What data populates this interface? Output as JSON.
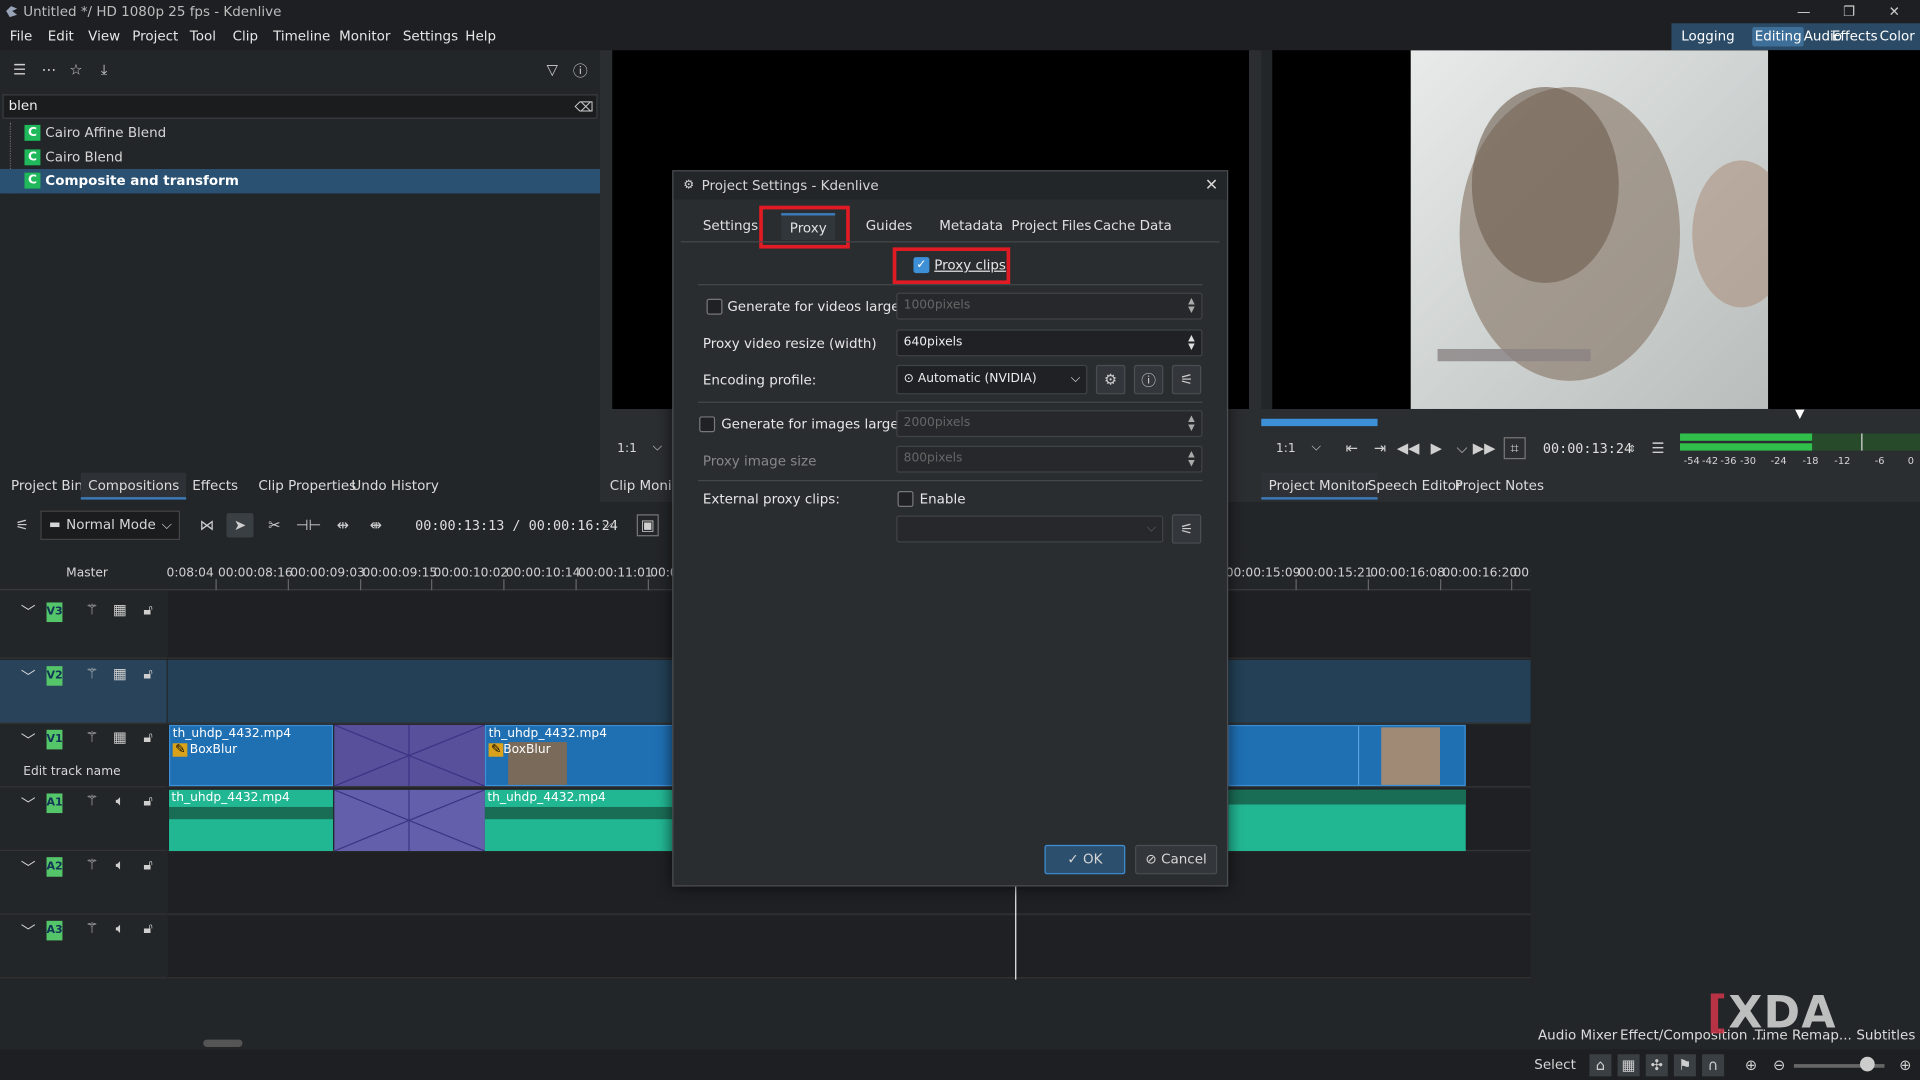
{
  "window": {
    "title": "Untitled */ HD 1080p 25 fps - Kdenlive",
    "controls": [
      "—",
      "❐",
      "✕"
    ]
  },
  "menu": [
    "File",
    "Edit",
    "View",
    "Project",
    "Tool",
    "Clip",
    "Timeline",
    "Monitor",
    "Settings",
    "Help"
  ],
  "layouts": [
    {
      "label": "Logging"
    },
    {
      "label": "Editing",
      "active": true
    },
    {
      "label": "Audio"
    },
    {
      "label": "Effects"
    },
    {
      "label": "Color"
    }
  ],
  "bin": {
    "search": "blen",
    "items": [
      {
        "label": "Cairo Affine Blend",
        "badge": "C"
      },
      {
        "label": "Cairo Blend",
        "badge": "C"
      },
      {
        "label": "Composite and transform",
        "badge": "C",
        "selected": true
      }
    ]
  },
  "leftTabs": [
    "Project Bin",
    "Compositions",
    "Effects",
    "Clip Properties",
    "Undo History"
  ],
  "clipMonitor": {
    "zoom": "1:1",
    "tab": "Clip Monito"
  },
  "projectMonitor": {
    "zoom": "1:1",
    "timecode": "00:00:13:24",
    "tabs": [
      "Project Monitor",
      "Speech Editor",
      "Project Notes"
    ],
    "meterLabels": [
      "-54",
      "-42",
      "-36",
      "-30",
      "-24",
      "-18",
      "-12",
      "-6",
      "0"
    ]
  },
  "timeline": {
    "mode": "Normal Mode",
    "timecode": "00:00:13:13 / 00:00:16:24",
    "master": "Master",
    "rulerLeft": [
      "0:08:04",
      "00:00:08:16",
      "00:00:09:03",
      "00:00:09:15",
      "00:00:10:02",
      "00:00:10:14",
      "00:00:11:01",
      "00:0"
    ],
    "rulerRight": [
      "00:00:15:09",
      "00:00:15:21",
      "00:00:16:08",
      "00:00:16:20",
      "00:"
    ],
    "tracks": [
      "V3",
      "V2",
      "V1",
      "A1",
      "A2",
      "A3"
    ],
    "editName": "Edit track name",
    "clipName": "th_uhdp_4432.mp4",
    "effect": "BoxBlur"
  },
  "rightTabs": [
    "Audio Mixer",
    "Effect/Composition ...",
    "Time Remap...",
    "Subtitles"
  ],
  "status": {
    "select": "Select"
  },
  "watermark": "XDA",
  "dialog": {
    "title": "Project Settings - Kdenlive",
    "tabs": [
      "Settings",
      "Proxy",
      "Guides",
      "Metadata",
      "Project Files",
      "Cache Data"
    ],
    "activeTab": "Proxy",
    "proxyClips": {
      "label": "Proxy clips",
      "checked": true
    },
    "genVideos": {
      "label": "Generate for videos larger than",
      "value": "1000pixels",
      "checked": false
    },
    "resize": {
      "label": "Proxy video resize (width)",
      "value": "640pixels"
    },
    "encoding": {
      "label": "Encoding profile:",
      "value": "Automatic (NVIDIA)"
    },
    "genImages": {
      "label": "Generate for images larger than",
      "value": "2000pixels",
      "checked": false
    },
    "imageSize": {
      "label": "Proxy image size",
      "value": "800pixels"
    },
    "external": {
      "label": "External proxy clips:",
      "enable": "Enable",
      "checked": false
    },
    "ok": "OK",
    "cancel": "Cancel"
  }
}
